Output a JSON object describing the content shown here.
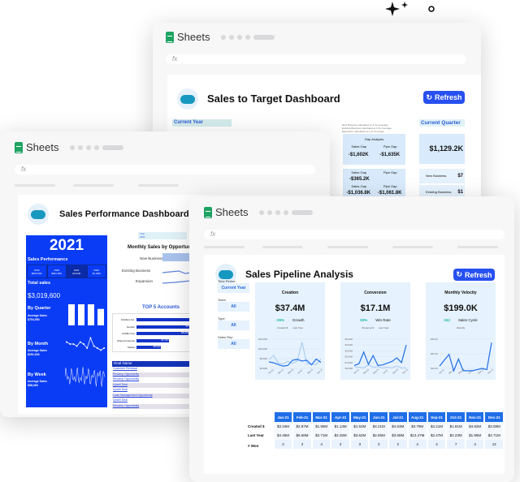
{
  "back": {
    "app": "Sheets",
    "fx": "fx",
    "title": "Sales to Target Dashboard",
    "refresh": "Refresh",
    "current_year": "Current Year",
    "current_quarter": "Current Quarter",
    "notes": [
      "New Business calculated at 1.4x coverage",
      "Existing Business calculated at 1.5x coverage",
      "Expansion calculated at 1.4x coverage"
    ],
    "gap_title": "Gap Analysis",
    "gap1": {
      "a_label": "Sales Gap",
      "a": "-$1,602K",
      "b_label": "Pipe Gap",
      "b": "-$1,635K"
    },
    "gap2": {
      "a_label": "Sales Gap",
      "a": "-$365.2K",
      "b_label": "Pipe Gap"
    },
    "gap3": {
      "a_label": "Sales Gap",
      "a": "-$1,036.8K",
      "b_label": "Pipe Gap",
      "b": "-$1,061.8K"
    },
    "quarter_value": "$1,129.2K",
    "q_rows": [
      {
        "label": "New Business",
        "value": "$7"
      },
      {
        "label": "Existing Business",
        "value": "$1"
      }
    ],
    "partial_k": "K"
  },
  "middle": {
    "app": "Sheets",
    "fx": "fx",
    "title": "Sales Performance Dashboard",
    "year": "2021",
    "sales_perf": "Sales Performance",
    "years": [
      {
        "y": "2019",
        "v": "$600.00K"
      },
      {
        "y": "2020",
        "v": "$991.00K"
      },
      {
        "y": "2021",
        "v": "$3.02M"
      },
      {
        "y": "2022",
        "v": "$1.29M"
      }
    ],
    "total_label": "Total sales",
    "total": "$3,019,600",
    "by_quarter": "By Quarter",
    "avg_label": "Average Sales",
    "q_avg": "$754,900",
    "by_month": "By Month",
    "m_avg": "$251,633",
    "by_week": "By Week",
    "w_avg": "$58,069",
    "quarter_bars": [
      1,
      1,
      1,
      0.78
    ],
    "month_points": [
      5,
      4,
      4,
      3,
      5,
      4,
      2,
      7,
      3,
      2,
      1,
      2
    ],
    "year_filter_label": "Year",
    "year_filter": "2021",
    "monthly_title": "Monthly Sales by Opportun",
    "opp": [
      "New Business",
      "Existing Business",
      "Expansion"
    ],
    "top5_title": "TOP 5 Accounts",
    "accounts": [
      {
        "name": "Robbins Inc.",
        "share": 1
      },
      {
        "name": "Gordon",
        "share": 0.98,
        "v": "$70"
      },
      {
        "name": "ACME Corp",
        "share": 0.97,
        "v": "$69,600"
      },
      {
        "name": "Shared Interests",
        "share": 0.6,
        "v": "$47,200"
      },
      {
        "name": "Stokes",
        "share": 0.45,
        "v": "$35,800"
      }
    ],
    "deal_header": "Deal Name",
    "deals": [
      "Customer Renewal",
      "Revamp Opportunity",
      "Revamp Opportunity",
      "Upsell Deal",
      "Upsell Deal",
      "Case Management Opportunity",
      "Upsell Deal",
      "Revamp Opportunity"
    ]
  },
  "front": {
    "app": "Sheets",
    "fx": "fx",
    "title": "Sales Pipeline Analysis",
    "refresh": "Refresh",
    "filters": [
      {
        "label": "Time Period",
        "value": "Current Year"
      },
      {
        "label": "Team",
        "value": "All"
      },
      {
        "label": "Type",
        "value": "All"
      },
      {
        "label": "Sales Rep",
        "value": "All"
      }
    ],
    "cards": [
      {
        "title": "Creation",
        "value": "$37.4M",
        "stat": "-26%",
        "stat_label": "Growth",
        "legend": [
          "Created $",
          "Last Year"
        ],
        "yticks": [
          "$15.00M",
          "$10.00M",
          "$5.00M",
          "$0.00M"
        ],
        "ymax": 15,
        "s1": [
          3.34,
          2.87,
          1.95,
          1.14,
          1.52,
          4.21,
          4.63,
          3.79,
          4.21,
          1.81,
          4.82,
          3.08
        ],
        "s2": [
          4.45,
          6.68,
          2.71,
          2.26,
          3.62,
          2.65,
          3.68,
          13.47,
          2.47,
          2.23,
          1.95,
          4.71
        ]
      },
      {
        "title": "Conversion",
        "value": "$17.1M",
        "stat": "53%",
        "stat_label": "Win Rate",
        "legend": [
          "Revenue $",
          "Last Year"
        ],
        "yticks": [
          "$5.00M",
          "$4.00M",
          "$3.00M",
          "$2.00M",
          "$1.00M",
          "$0.00M"
        ],
        "ymax": 5,
        "s1": [
          0.5,
          0.8,
          2.8,
          0.7,
          2.2,
          0.5,
          0.6,
          0.9,
          1.2,
          1.8,
          1.0,
          4.0
        ],
        "s2": [
          0.3,
          0.2,
          0.1,
          0.6,
          0.2,
          0.3,
          0.1,
          0.2,
          0.1,
          0.4,
          0.1,
          0.1
        ]
      },
      {
        "title": "Monthly Velocity",
        "value": "$199.0K",
        "stat": "243",
        "stat_label": "Sales Cycle",
        "legend": [
          "Velocity"
        ],
        "yticks": [
          "$30.0K",
          "$20.0K",
          "$10.0K"
        ],
        "ymax": 30,
        "s1": [
          7,
          12,
          17,
          3,
          13,
          3,
          3,
          3,
          4,
          5,
          4,
          27
        ]
      }
    ],
    "xticks": [
      "Jan-21",
      "Mar-21",
      "May-21",
      "Jul-21",
      "Sep-21",
      "Nov-21"
    ],
    "table": {
      "months": [
        "Jan-21",
        "Feb-21",
        "Mar-21",
        "Apr-21",
        "May-21",
        "Jun-21",
        "Jul-21",
        "Aug-21",
        "Sep-21",
        "Oct-21",
        "Nov-21",
        "Dec-21"
      ],
      "rows": [
        {
          "label": "Created $",
          "values": [
            "$3.34M",
            "$2.87M",
            "$1.95M",
            "$1.14M",
            "$1.52M",
            "$4.21M",
            "$4.63M",
            "$3.79M",
            "$4.21M",
            "$1.81M",
            "$4.82M",
            "$3.08M"
          ]
        },
        {
          "label": "Last Year",
          "values": [
            "$4.45M",
            "$6.68M",
            "$2.71M",
            "$2.26M",
            "$3.62M",
            "$2.65M",
            "$3.68M",
            "$13.47M",
            "$2.47M",
            "$2.23M",
            "$1.95M",
            "$4.71M"
          ]
        },
        {
          "label": "# Won",
          "values": [
            "2",
            "2",
            "4",
            "2",
            "3",
            "2",
            "2",
            "4",
            "4",
            "7",
            "4",
            "12"
          ]
        }
      ]
    }
  },
  "colors": {
    "accent": "#2750f0",
    "blue_panel": "#0a3cf5",
    "card_bg": "#e6f2fd",
    "line": "#1f6ee8",
    "stat": "#17b7a8"
  }
}
